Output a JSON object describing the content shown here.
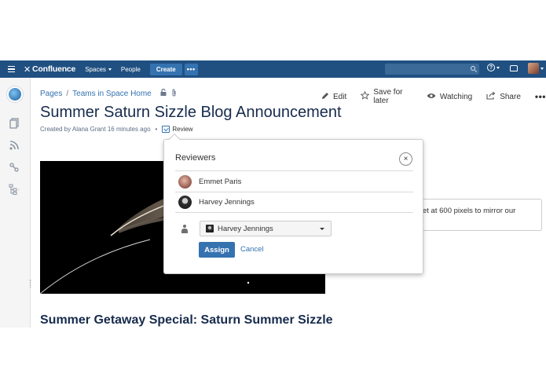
{
  "header": {
    "logo": "Confluence",
    "nav": [
      {
        "label": "Spaces"
      },
      {
        "label": "People"
      }
    ],
    "create_label": "Create",
    "more_label": "•••",
    "help_label": "?"
  },
  "breadcrumb": {
    "items": [
      "Pages",
      "Teams in Space Home"
    ],
    "separator": "/"
  },
  "page_actions": {
    "edit": "Edit",
    "save_for_later": "Save for later",
    "watching": "Watching",
    "share": "Share",
    "more": "•••"
  },
  "page": {
    "title": "Summer Saturn Sizzle Blog Announcement",
    "byline": "Created by Alana Grant 16 minutes ago",
    "byline_sep": "•",
    "review_label": "Review",
    "info_text": "et at 600 pixels to mirror our",
    "subtitle": "Summer Getaway Special: Saturn Summer Sizzle"
  },
  "dialog": {
    "title": "Reviewers",
    "close": "×",
    "reviewers": [
      {
        "name": "Emmet Paris"
      },
      {
        "name": "Harvey Jennings"
      }
    ],
    "select_value": "Harvey Jennings",
    "assign_label": "Assign",
    "cancel_label": "Cancel"
  },
  "colors": {
    "header_bg": "#205081",
    "link": "#3572b0",
    "primary_button": "#3572b0"
  },
  "icons": [
    "menu-icon",
    "search-icon",
    "help-icon",
    "notification-icon",
    "lock-icon",
    "attachment-icon",
    "edit-icon",
    "star-icon",
    "eye-icon",
    "share-icon",
    "review-icon",
    "person-icon"
  ]
}
